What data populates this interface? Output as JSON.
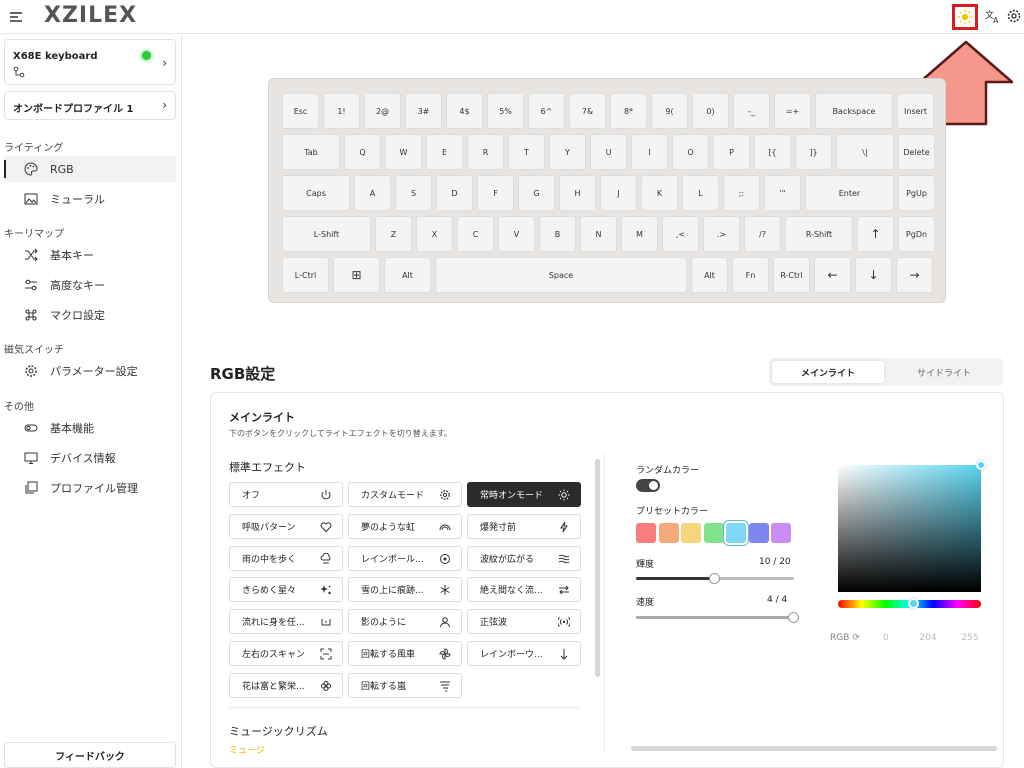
{
  "app": {
    "logo": "XZILEX"
  },
  "sidebar": {
    "device": {
      "name": "X68E keyboard",
      "status": "connected"
    },
    "profile": {
      "name": "オンボードプロファイル 1"
    },
    "sections": [
      {
        "title": "ライティング",
        "items": [
          {
            "label": "RGB",
            "icon": "palette-icon",
            "active": true
          },
          {
            "label": "ミューラル",
            "icon": "image-icon"
          }
        ]
      },
      {
        "title": "キーリマップ",
        "items": [
          {
            "label": "基本キー",
            "icon": "shuffle-icon"
          },
          {
            "label": "高度なキー",
            "icon": "sliders-icon"
          },
          {
            "label": "マクロ設定",
            "icon": "command-icon"
          }
        ]
      },
      {
        "title": "磁気スイッチ",
        "items": [
          {
            "label": "パラメーター設定",
            "icon": "gear-icon"
          }
        ]
      },
      {
        "title": "その他",
        "items": [
          {
            "label": "基本機能",
            "icon": "toggle-icon"
          },
          {
            "label": "デバイス情報",
            "icon": "monitor-icon"
          },
          {
            "label": "プロファイル管理",
            "icon": "layers-icon"
          }
        ]
      }
    ],
    "feedback": "フィードバック"
  },
  "keyboard": {
    "rows": [
      [
        "Esc",
        "1!",
        "2@",
        "3#",
        "4$",
        "5%",
        "6^",
        "7&",
        "8*",
        "9(",
        "0)",
        "-_",
        "=+",
        "Backspace",
        "Insert"
      ],
      [
        "Tab",
        "Q",
        "W",
        "E",
        "R",
        "T",
        "Y",
        "U",
        "I",
        "O",
        "P",
        "[{",
        "]}",
        "\\|",
        "Delete"
      ],
      [
        "Caps",
        "A",
        "S",
        "D",
        "F",
        "G",
        "H",
        "J",
        "K",
        "L",
        ";:",
        "'\"",
        "Enter",
        "PgUp"
      ],
      [
        "L-Shift",
        "Z",
        "X",
        "C",
        "V",
        "B",
        "N",
        "M",
        ",<",
        ".>",
        "/?",
        "R-Shift",
        "↑",
        "PgDn"
      ],
      [
        "L-Ctrl",
        "⊞",
        "Alt",
        "Space",
        "Alt",
        "Fn",
        "R-Ctrl",
        "←",
        "↓",
        "→"
      ]
    ]
  },
  "rgb": {
    "title": "RGB設定",
    "tabs": [
      "メインライト",
      "サイドライト"
    ],
    "panel_title": "メインライト",
    "panel_desc": "下のボタンをクリックしてライトエフェクトを切り替えます。",
    "standard_title": "標準エフェクト",
    "effects": [
      {
        "label": "オフ",
        "icon": "power-icon"
      },
      {
        "label": "カスタムモード",
        "icon": "gear-icon"
      },
      {
        "label": "常時オンモード",
        "icon": "sun-icon",
        "selected": true
      },
      {
        "label": "呼吸パターン",
        "icon": "heart-icon"
      },
      {
        "label": "夢のような虹",
        "icon": "rainbow-icon"
      },
      {
        "label": "爆発寸前",
        "icon": "bolt-icon"
      },
      {
        "label": "雨の中を歩く",
        "icon": "rain-icon"
      },
      {
        "label": "レインボール...",
        "icon": "target-icon"
      },
      {
        "label": "波紋が広がる",
        "icon": "waves-icon"
      },
      {
        "label": "きらめく星々",
        "icon": "sparkle-icon"
      },
      {
        "label": "雪の上に痕跡...",
        "icon": "snowflake-icon"
      },
      {
        "label": "絶え間なく流...",
        "icon": "swap-icon"
      },
      {
        "label": "流れに身を任...",
        "icon": "flow-icon"
      },
      {
        "label": "影のように",
        "icon": "person-icon"
      },
      {
        "label": "正弦波",
        "icon": "broadcast-icon"
      },
      {
        "label": "左右のスキャン",
        "icon": "scan-icon"
      },
      {
        "label": "回転する風車",
        "icon": "pinwheel-icon"
      },
      {
        "label": "レインボーウ...",
        "icon": "arrow-down-icon"
      },
      {
        "label": "花は富と繁栄...",
        "icon": "flower-icon"
      },
      {
        "label": "回転する嵐",
        "icon": "storm-icon"
      }
    ],
    "music_title": "ミュージックリズム",
    "music_sub": "ミュージ",
    "random_label": "ランダムカラー",
    "random_on": true,
    "preset_label": "プリセットカラー",
    "presets": [
      "#f77e7e",
      "#f5a97a",
      "#f6d57c",
      "#7ee38a",
      "#7fd8f5",
      "#7f86f2",
      "#c98cf2"
    ],
    "selected_preset": 4,
    "brightness": {
      "label": "輝度",
      "value_text": "10 / 20",
      "value": 10,
      "max": 20
    },
    "speed": {
      "label": "速度",
      "value_text": "4 / 4",
      "value": 4,
      "max": 4
    },
    "color": {
      "hex": "#58d3f0",
      "rgb_label": "RGB",
      "r": "0",
      "g": "204",
      "b": "255"
    }
  }
}
